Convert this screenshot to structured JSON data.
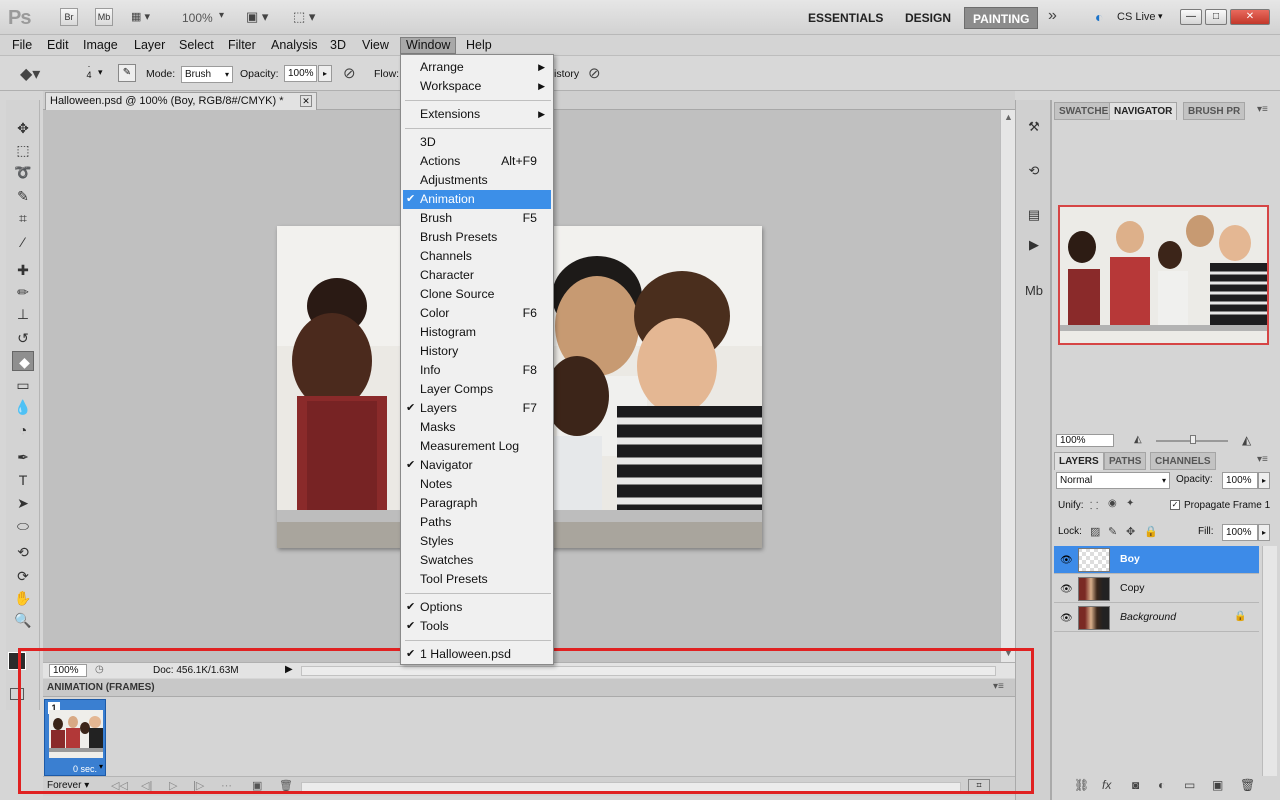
{
  "app": {
    "logo": "Ps",
    "bridge": "Br",
    "minibridge": "Mb",
    "zoom": "100%",
    "workspaces": [
      "ESSENTIALS",
      "DESIGN",
      "PAINTING"
    ],
    "active_workspace": "PAINTING",
    "cs_live": "CS Live",
    "win_controls": [
      "—",
      "□",
      "✕"
    ]
  },
  "menubar": {
    "items": [
      "File",
      "Edit",
      "Image",
      "Layer",
      "Select",
      "Filter",
      "Analysis",
      "3D",
      "View",
      "Window",
      "Help"
    ],
    "open": "Window"
  },
  "options": {
    "brush_size": "4",
    "mode_label": "Mode:",
    "mode_value": "Brush",
    "opacity_label": "Opacity:",
    "opacity_value": "100%",
    "flow_label": "Flow:",
    "history_label": "istory"
  },
  "document": {
    "tab_title": "Halloween.psd @ 100% (Boy, RGB/8#/CMYK) *",
    "status_zoom": "100%",
    "status_doc": "Doc: 456.1K/1.63M"
  },
  "window_menu": {
    "items": [
      {
        "label": "Arrange",
        "arrow": true
      },
      {
        "label": "Workspace",
        "arrow": true
      },
      {
        "sep": true
      },
      {
        "label": "Extensions",
        "arrow": true
      },
      {
        "sep": true
      },
      {
        "label": "3D"
      },
      {
        "label": "Actions",
        "shortcut": "Alt+F9"
      },
      {
        "label": "Adjustments"
      },
      {
        "label": "Animation",
        "checked": true,
        "highlighted": true
      },
      {
        "label": "Brush",
        "shortcut": "F5"
      },
      {
        "label": "Brush Presets"
      },
      {
        "label": "Channels"
      },
      {
        "label": "Character"
      },
      {
        "label": "Clone Source"
      },
      {
        "label": "Color",
        "shortcut": "F6"
      },
      {
        "label": "Histogram"
      },
      {
        "label": "History"
      },
      {
        "label": "Info",
        "shortcut": "F8"
      },
      {
        "label": "Layer Comps"
      },
      {
        "label": "Layers",
        "shortcut": "F7",
        "checked": true
      },
      {
        "label": "Masks"
      },
      {
        "label": "Measurement Log"
      },
      {
        "label": "Navigator",
        "checked": true
      },
      {
        "label": "Notes"
      },
      {
        "label": "Paragraph"
      },
      {
        "label": "Paths"
      },
      {
        "label": "Styles"
      },
      {
        "label": "Swatches"
      },
      {
        "label": "Tool Presets"
      },
      {
        "sep": true
      },
      {
        "label": "Options",
        "checked": true
      },
      {
        "label": "Tools",
        "checked": true
      },
      {
        "sep": true
      },
      {
        "label": "1 Halloween.psd",
        "checked": true
      }
    ]
  },
  "animation": {
    "title": "ANIMATION (FRAMES)",
    "frame_number": "1",
    "frame_delay": "0 sec.",
    "loop": "Forever"
  },
  "navigator": {
    "tabs": [
      "SWATCHE",
      "NAVIGATOR",
      "BRUSH PR"
    ],
    "active_tab": "NAVIGATOR",
    "zoom": "100%"
  },
  "layers": {
    "tabs": [
      "LAYERS",
      "PATHS",
      "CHANNELS"
    ],
    "active_tab": "LAYERS",
    "blend_mode": "Normal",
    "opacity_label": "Opacity:",
    "opacity": "100%",
    "unify_label": "Unify:",
    "propagate_label": "Propagate Frame 1",
    "lock_label": "Lock:",
    "fill_label": "Fill:",
    "fill": "100%",
    "rows": [
      {
        "name": "Boy",
        "active": true
      },
      {
        "name": "Copy",
        "active": false
      },
      {
        "name": "Background",
        "active": false,
        "locked": true
      }
    ]
  },
  "colors": {
    "accent": "#3c8fe8",
    "highlight_box": "#e02121"
  }
}
